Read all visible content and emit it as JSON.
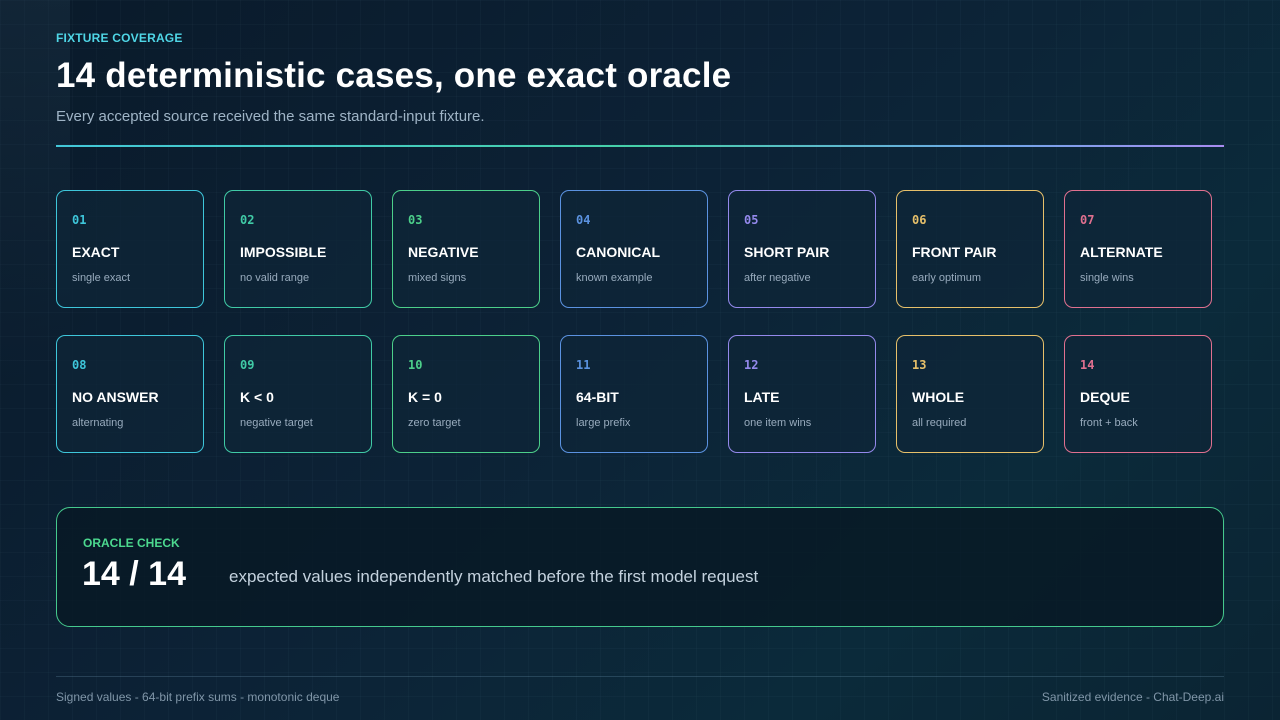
{
  "header": {
    "eyebrow": "FIXTURE COVERAGE",
    "title": "14 deterministic cases, one exact oracle",
    "subtitle": "Every accepted source received the same standard-input fixture."
  },
  "cases": [
    {
      "num": "01",
      "name": "EXACT",
      "desc": "single exact",
      "color": "#3ec6da"
    },
    {
      "num": "02",
      "name": "IMPOSSIBLE",
      "desc": "no valid range",
      "color": "#40caa6"
    },
    {
      "num": "03",
      "name": "NEGATIVE",
      "desc": "mixed signs",
      "color": "#4ccf8a"
    },
    {
      "num": "04",
      "name": "CANONICAL",
      "desc": "known example",
      "color": "#5b92e0"
    },
    {
      "num": "05",
      "name": "SHORT PAIR",
      "desc": "after negative",
      "color": "#9489ec"
    },
    {
      "num": "06",
      "name": "FRONT PAIR",
      "desc": "early optimum",
      "color": "#e6c06a"
    },
    {
      "num": "07",
      "name": "ALTERNATE",
      "desc": "single wins",
      "color": "#e0708f"
    },
    {
      "num": "08",
      "name": "NO ANSWER",
      "desc": "alternating",
      "color": "#3ec6da"
    },
    {
      "num": "09",
      "name": "K < 0",
      "desc": "negative target",
      "color": "#40caa6"
    },
    {
      "num": "10",
      "name": "K = 0",
      "desc": "zero target",
      "color": "#4ccf8a"
    },
    {
      "num": "11",
      "name": "64-BIT",
      "desc": "large prefix",
      "color": "#5b92e0"
    },
    {
      "num": "12",
      "name": "LATE",
      "desc": "one item wins",
      "color": "#9489ec"
    },
    {
      "num": "13",
      "name": "WHOLE",
      "desc": "all required",
      "color": "#e6c06a"
    },
    {
      "num": "14",
      "name": "DEQUE",
      "desc": "front + back",
      "color": "#e0708f"
    }
  ],
  "oracle": {
    "label": "ORACLE CHECK",
    "score": "14 / 14",
    "text": "expected values independently matched before the first model request"
  },
  "footer": {
    "left": "Signed values - 64-bit prefix sums - monotonic deque",
    "right": "Sanitized evidence - Chat-Deep.ai"
  }
}
